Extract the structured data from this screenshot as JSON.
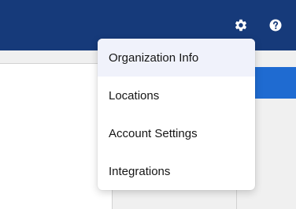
{
  "header": {
    "background_color": "#163a7a",
    "icons": [
      {
        "name": "gear-icon",
        "glyph": "gear"
      },
      {
        "name": "help-icon",
        "glyph": "question-circle"
      }
    ]
  },
  "menu": {
    "items": [
      {
        "label": "Organization Info",
        "active": true
      },
      {
        "label": "Locations",
        "active": false
      },
      {
        "label": "Account Settings",
        "active": false
      },
      {
        "label": "Integrations",
        "active": false
      }
    ],
    "active_color": "#f0f2fb"
  },
  "colors": {
    "accent_blue": "#1f6bd1",
    "page_background": "#f0f0f0"
  }
}
